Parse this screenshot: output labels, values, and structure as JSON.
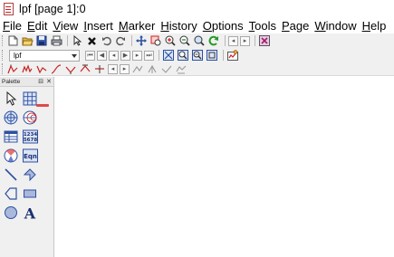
{
  "window": {
    "title": "lpf [page 1]:0"
  },
  "menubar": {
    "items": [
      {
        "u": "F",
        "rest": "ile"
      },
      {
        "u": "E",
        "rest": "dit"
      },
      {
        "u": "V",
        "rest": "iew"
      },
      {
        "u": "I",
        "rest": "nsert"
      },
      {
        "u": "M",
        "rest": "arker"
      },
      {
        "u": "H",
        "rest": "istory"
      },
      {
        "u": "O",
        "rest": "ptions"
      },
      {
        "u": "T",
        "rest": "ools"
      },
      {
        "u": "P",
        "rest": "age"
      },
      {
        "u": "W",
        "rest": "indow"
      },
      {
        "u": "H",
        "rest": "elp"
      }
    ]
  },
  "toolbar2": {
    "combo_value": "lpf"
  },
  "palette": {
    "title": "Palette",
    "table_label_top": "1234",
    "table_label_bottom": "5678",
    "equation_label": "Eqn",
    "text_tool_glyph": "A"
  },
  "colors": {
    "accent_red": "#cc2222",
    "palette_blue": "#2c4fa0",
    "title_icon": "#d02020"
  }
}
